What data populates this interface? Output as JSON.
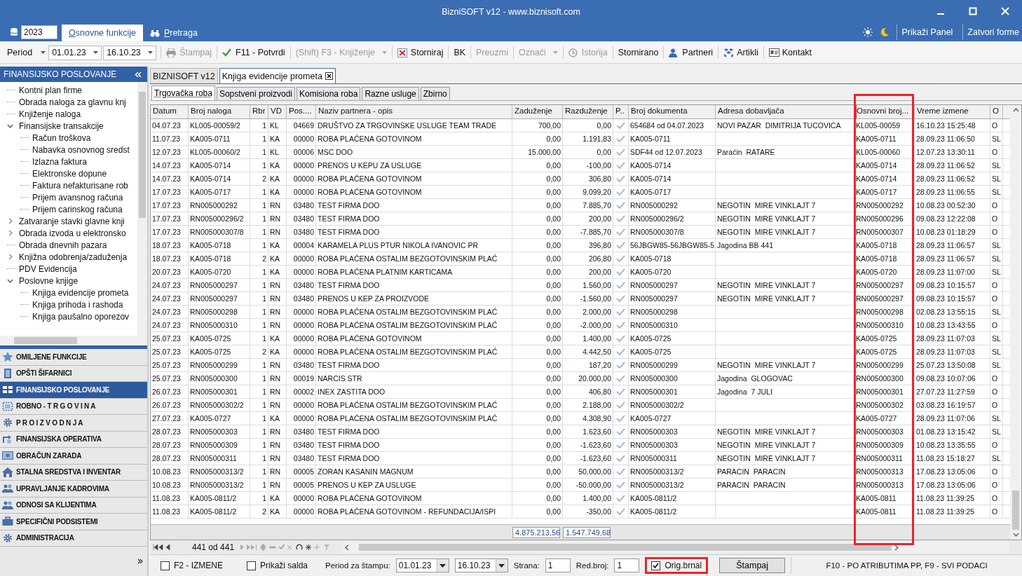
{
  "window": {
    "title": "BizniSOFT v12 - www.biznisoft.com"
  },
  "ribbon": {
    "year": "2023",
    "tabs": [
      {
        "label": "Osnovne funkcije",
        "selected": true
      },
      {
        "label": "Pretraga",
        "selected": false
      }
    ],
    "right_buttons": [
      "Prikaži Panel",
      "Zatvori forme"
    ]
  },
  "toolbar": {
    "period_label": "Period",
    "date_from": "01.01.23",
    "date_to": "16.10.23",
    "buttons": [
      {
        "label": "Štampaj",
        "disabled": true,
        "dropdown": false
      },
      {
        "label": "F11 - Potvrdi",
        "disabled": false,
        "dropdown": false
      },
      {
        "label": "(Shift) F3 - Knjiženje",
        "disabled": true,
        "dropdown": true
      },
      {
        "label": "Storniraj",
        "disabled": false,
        "dropdown": false
      },
      {
        "label": "BK",
        "disabled": false,
        "dropdown": false
      },
      {
        "label": "Preuzmi",
        "disabled": true,
        "dropdown": false
      },
      {
        "label": "Označi",
        "disabled": true,
        "dropdown": true
      },
      {
        "label": "Istorija",
        "disabled": true,
        "dropdown": false
      },
      {
        "label": "Stornirano",
        "disabled": false,
        "dropdown": false
      },
      {
        "label": "Partneri",
        "disabled": false,
        "dropdown": false
      },
      {
        "label": "Artikli",
        "disabled": false,
        "dropdown": false
      },
      {
        "label": "Kontakt",
        "disabled": false,
        "dropdown": false
      }
    ]
  },
  "sidebar": {
    "title": "FINANSIJSKO POSLOVANJE",
    "tree": [
      {
        "label": "Kontni plan firme"
      },
      {
        "label": "Obrada naloga za glavnu knj"
      },
      {
        "label": "Knjiženje naloga"
      },
      {
        "label": "Finansijske transakcije",
        "expanded": true,
        "children": [
          {
            "label": "Račun troškova"
          },
          {
            "label": "Nabavka osnovnog sredst"
          },
          {
            "label": "Izlazna faktura"
          },
          {
            "label": "Elektronske dopune"
          },
          {
            "label": "Faktura nefakturisane rob"
          },
          {
            "label": "Prijem avansnog računa"
          },
          {
            "label": "Prijem carinskog računa"
          }
        ]
      },
      {
        "label": "Zatvaranje stavki glavne knji",
        "expanded": false
      },
      {
        "label": "Obrada izvoda u elektronsko",
        "expanded": false
      },
      {
        "label": "Obrada dnevnih pazara"
      },
      {
        "label": "Knjižna odobrenja/zaduženja",
        "expanded": false
      },
      {
        "label": "PDV Evidencija"
      },
      {
        "label": "Poslovne knjige",
        "expanded": true,
        "children": [
          {
            "label": "Knjiga evidencije prometa"
          },
          {
            "label": "Knjiga prihoda i rashoda"
          },
          {
            "label": "Knjiga paušalno oporezov"
          }
        ]
      }
    ],
    "sections": [
      {
        "label": "OMILJENE FUNKCIJE",
        "selected": false
      },
      {
        "label": "OPŠTI ŠIFARNICI",
        "selected": false
      },
      {
        "label": "FINANSIJSKO POSLOVANJE",
        "selected": true
      },
      {
        "label": "ROBNO - T R G O V I N A",
        "selected": false
      },
      {
        "label": "P R O I Z V O D N J A",
        "selected": false
      },
      {
        "label": "FINANSIJSKA OPERATIVA",
        "selected": false
      },
      {
        "label": "OBRAČUN ZARADA",
        "selected": false
      },
      {
        "label": "STALNA SREDSTVA I INVENTAR",
        "selected": false
      },
      {
        "label": "UPRAVLJANJE KADROVIMA",
        "selected": false
      },
      {
        "label": "ODNOSI SA KLIJENTIMA",
        "selected": false
      },
      {
        "label": "SPECIFIČNI PODSISTEMI",
        "selected": false
      },
      {
        "label": "ADMINISTRACIJA",
        "selected": false
      }
    ]
  },
  "doc_tabs": [
    {
      "label": "BIZNISOFT v12",
      "selected": false,
      "closable": false
    },
    {
      "label": "Knjiga evidencije prometa",
      "selected": true,
      "closable": true
    }
  ],
  "sub_tabs": [
    {
      "label": "Trgovačka roba",
      "selected": true
    },
    {
      "label": "Sopstveni proizvodi",
      "selected": false
    },
    {
      "label": "Komisiona roba",
      "selected": false
    },
    {
      "label": "Razne usluge",
      "selected": false
    },
    {
      "label": "Zbirno",
      "selected": false
    }
  ],
  "table": {
    "columns": [
      {
        "label": "Datum",
        "kind": "text",
        "highlight": false
      },
      {
        "label": "Broj naloga",
        "kind": "text",
        "highlight": false
      },
      {
        "label": "Rbr",
        "kind": "num",
        "highlight": false
      },
      {
        "label": "VD",
        "kind": "text",
        "highlight": false
      },
      {
        "label": "Pos....",
        "kind": "num",
        "highlight": false
      },
      {
        "label": "Naziv partnera - opis",
        "kind": "text",
        "highlight": false
      },
      {
        "label": "Zaduženje",
        "kind": "num",
        "highlight": false
      },
      {
        "label": "Razduženje",
        "kind": "num",
        "highlight": false
      },
      {
        "label": "P..",
        "kind": "check",
        "highlight": false
      },
      {
        "label": "Broj dokumenta",
        "kind": "text",
        "highlight": false
      },
      {
        "label": "Adresa dobavljača",
        "kind": "text",
        "highlight": false
      },
      {
        "label": "Osnovni broj...",
        "kind": "text",
        "highlight": true
      },
      {
        "label": "Vreme izmene",
        "kind": "text",
        "highlight": false
      },
      {
        "label": "O",
        "kind": "text",
        "highlight": false
      }
    ],
    "rows": [
      [
        "04.07.23",
        "KL005-00059/2",
        "1",
        "KL",
        "04669",
        "DRUŠTVO ZA TRGOVINSKE USLUGE TEAM TRADE",
        "700,00",
        "0,00",
        true,
        "654684 od 04.07.2023",
        "NOVI PAZAR  DIMITRIJA TUCOVICA",
        "KL005-00059",
        "16.10.23 15:25:48",
        "O"
      ],
      [
        "11.07.23",
        "KA005-0711",
        "1",
        "KA",
        "00000",
        "ROBA PLAĆENA GOTOVINOM",
        "0,00",
        "1.191,83",
        true,
        "KA005-0711",
        null,
        "KA005-0711",
        "28.09.23 11:06:50",
        "SL"
      ],
      [
        "12.07.23",
        "KL005-00060/2",
        "1",
        "KL",
        "00006",
        "MSC DOO",
        "15.000,00",
        "0,00",
        true,
        "SDF44 od 12.07.2023",
        "Paraćin  RATARE",
        "KL005-00060",
        "12.07.23 13:30:11",
        "O"
      ],
      [
        "14.07.23",
        "KA005-0714",
        "1",
        "KA",
        "00000",
        "PRENOS U KEPU ZA USLUGE",
        "0,00",
        "-100,00",
        true,
        "KA005-0714",
        null,
        "KA005-0714",
        "28.09.23 11:06:52",
        "SL"
      ],
      [
        "14.07.23",
        "KA005-0714",
        "2",
        "KA",
        "00000",
        "ROBA PLAĆENA GOTOVINOM",
        "0,00",
        "306,80",
        true,
        "KA005-0714",
        null,
        "KA005-0714",
        "28.09.23 11:06:52",
        "SL"
      ],
      [
        "17.07.23",
        "KA005-0717",
        "1",
        "KA",
        "00000",
        "ROBA PLAĆENA GOTOVINOM",
        "0,00",
        "9.099,20",
        true,
        "KA005-0717",
        null,
        "KA005-0717",
        "28.09.23 11:06:55",
        "SL"
      ],
      [
        "17.07.23",
        "RN005000292",
        "1",
        "RN",
        "03480",
        "TEST FIRMA DOO",
        "0,00",
        "7.885,70",
        true,
        "RN005000292",
        "NEGOTIN  MIRE VINKLAJT 7",
        "RN005000292",
        "10.08.23 00:52:30",
        "O"
      ],
      [
        "17.07.23",
        "RN005000296/2",
        "1",
        "RN",
        "03480",
        "TEST FIRMA DOO",
        "0,00",
        "200,00",
        true,
        "RN005000296/2",
        "NEGOTIN  MIRE VINKLAJT 7",
        "RN005000296",
        "09.08.23 12:22:08",
        "O"
      ],
      [
        "17.07.23",
        "RN005000307/8",
        "1",
        "RN",
        "03480",
        "TEST FIRMA DOO",
        "0,00",
        "-7.885,70",
        true,
        "RN005000307/8",
        "NEGOTIN  MIRE VINKLAJT 7",
        "RN005000307",
        "10.08.23 01:18:29",
        "O"
      ],
      [
        "18.07.23",
        "KA005-0718",
        "1",
        "KA",
        "00004",
        "KARAMELA PLUS PTUR NIKOLA IVANOVIC PR",
        "0,00",
        "396,80",
        true,
        "56JBGW85-56JBGW85-5",
        "Jagodina BB 441",
        "KA005-0718",
        "28.09.23 11:06:57",
        "SL"
      ],
      [
        "18.07.23",
        "KA005-0718",
        "2",
        "KA",
        "00000",
        "ROBA PLAĆENA OSTALIM BEZGOTOVINSKIM PLAĆ",
        "0,00",
        "206,80",
        true,
        "KA005-0718",
        null,
        "KA005-0718",
        "28.09.23 11:06:57",
        "SL"
      ],
      [
        "20.07.23",
        "KA005-0720",
        "1",
        "KA",
        "00000",
        "ROBA PLAĆENA PLATNIM KARTICAMA",
        "0,00",
        "200,00",
        true,
        "KA005-0720",
        null,
        "KA005-0720",
        "28.09.23 11:07:00",
        "SL"
      ],
      [
        "24.07.23",
        "RN005000297",
        "1",
        "RN",
        "03480",
        "TEST FIRMA DOO",
        "0,00",
        "1.560,00",
        true,
        "RN005000297",
        "NEGOTIN  MIRE VINKLAJT 7",
        "RN005000297",
        "09.08.23 10:15:57",
        "O"
      ],
      [
        "24.07.23",
        "RN005000297",
        "1",
        "RN",
        "03480",
        "PRENOS U KEP ZA PROIZVODE",
        "0,00",
        "-1.560,00",
        true,
        "RN005000297",
        "NEGOTIN  MIRE VINKLAJT 7",
        "RN005000297",
        "09.08.23 10:15:57",
        "O"
      ],
      [
        "24.07.23",
        "RN005000298",
        "1",
        "RN",
        "00000",
        "ROBA PLAĆENA OSTALIM BEZGOTOVINSKIM PLAĆ",
        "0,00",
        "2.000,00",
        true,
        "RN005000298",
        null,
        "RN005000298",
        "02.08.23 13:55:15",
        "SL"
      ],
      [
        "24.07.23",
        "RN005000310",
        "1",
        "RN",
        "00000",
        "ROBA PLAĆENA OSTALIM BEZGOTOVINSKIM PLAĆ",
        "0,00",
        "-2.000,00",
        true,
        "RN005000310",
        null,
        "RN005000310",
        "10.08.23 13:43:55",
        "O"
      ],
      [
        "25.07.23",
        "KA005-0725",
        "1",
        "KA",
        "00000",
        "ROBA PLAĆENA GOTOVINOM",
        "0,00",
        "1.400,00",
        true,
        "KA005-0725",
        null,
        "KA005-0725",
        "28.09.23 11:07:03",
        "SL"
      ],
      [
        "25.07.23",
        "KA005-0725",
        "2",
        "KA",
        "00000",
        "ROBA PLAĆENA OSTALIM BEZGOTOVINSKIM PLAĆ",
        "0,00",
        "4.442,50",
        true,
        "KA005-0725",
        null,
        "KA005-0725",
        "28.09.23 11:07:03",
        "SL"
      ],
      [
        "25.07.23",
        "RN005000299",
        "1",
        "RN",
        "03480",
        "TEST FIRMA DOO",
        "0,00",
        "187,20",
        true,
        "RN005000299",
        "NEGOTIN  MIRE VINKLAJT 7",
        "RN005000299",
        "25.07.23 13:50:08",
        "SL"
      ],
      [
        "25.07.23",
        "RN005000300",
        "1",
        "RN",
        "00019",
        "NARCIS STR",
        "0,00",
        "20.000,00",
        true,
        "RN005000300",
        "Jagodina  GLOGOVAC",
        "RN005000300",
        "09.08.23 10:07:06",
        "O"
      ],
      [
        "26.07.23",
        "RN005000301",
        "1",
        "RN",
        "00002",
        "INEX ZASTITA DOO",
        "0,00",
        "406,80",
        true,
        "RN005000301",
        "Jagodina  7 JULI",
        "RN005000301",
        "27.07.23 11:27:59",
        "O"
      ],
      [
        "26.07.23",
        "RN005000302/2",
        "1",
        "RN",
        "00000",
        "ROBA PLAĆENA OSTALIM BEZGOTOVINSKIM PLAĆ",
        "0,00",
        "2.188,00",
        true,
        "RN005000302/2",
        null,
        "RN005000302",
        "03.08.23 16:19:57",
        "O"
      ],
      [
        "27.07.23",
        "KA005-0727",
        "1",
        "KA",
        "00000",
        "ROBA PLAĆENA OSTALIM BEZGOTOVINSKIM PLAĆ",
        "0,00",
        "4.308,90",
        true,
        "KA005-0727",
        null,
        "KA005-0727",
        "28.09.23 11:07:06",
        "SL"
      ],
      [
        "28.07.23",
        "RN005000303",
        "1",
        "RN",
        "03480",
        "TEST FIRMA DOO",
        "0,00",
        "1.623,60",
        true,
        "RN005000303",
        "NEGOTIN  MIRE VINKLAJT 7",
        "RN005000303",
        "01.08.23 13:15:42",
        "SL"
      ],
      [
        "28.07.23",
        "RN005000309",
        "1",
        "RN",
        "03480",
        "TEST FIRMA DOO",
        "0,00",
        "-1.623,60",
        true,
        "RN005000303",
        "NEGOTIN  MIRE VINKLAJT 7",
        "RN005000309",
        "10.08.23 13:35:55",
        "O"
      ],
      [
        "28.07.23",
        "RN005000311",
        "1",
        "RN",
        "03480",
        "TEST FIRMA DOO",
        "0,00",
        "-1.623,60",
        true,
        "RN005000311",
        "NEGOTIN  MIRE VINKLAJT 7",
        "RN005000311",
        "11.08.23 15:18:27",
        "SL"
      ],
      [
        "10.08.23",
        "RN005000313/2",
        "1",
        "RN",
        "00005",
        "ZORAN KASANIN MAGNUM",
        "0,00",
        "50.000,00",
        true,
        "RN005000313/2",
        "PARACIN  PARACIN",
        "RN005000313",
        "17.08.23 13:05:06",
        "O"
      ],
      [
        "10.08.23",
        "RN005000313/2",
        "1",
        "RN",
        "00005",
        "PRENOS U KEP ZA USLUGE",
        "0,00",
        "-50.000,00",
        true,
        "RN005000313/2",
        "PARACIN  PARACIN",
        "RN005000313",
        "17.08.23 13:05:06",
        "O"
      ],
      [
        "11.08.23",
        "KA005-0811/2",
        "1",
        "KA",
        "00000",
        "ROBA PLAĆENA GOTOVINOM",
        "0,00",
        "1.400,00",
        true,
        "KA005-0811/2",
        null,
        "KA005-0811",
        "11.08.23 11:39:25",
        "O"
      ],
      [
        "11.08.23",
        "KA005-0811/2",
        "2",
        "KA",
        "00000",
        "ROBA PLAĆENA GOTOVINOM - REFUNDACIJA/ISPI",
        "0,00",
        "-350,00",
        true,
        "KA005-0811/2",
        null,
        "KA005-0811",
        "11.08.23 11:39:25",
        "O"
      ]
    ],
    "totals": {
      "zaduzenje": "4.875.213,56",
      "razduzenje": "1.547.749,68"
    }
  },
  "navigator": {
    "position": "441 od 441"
  },
  "bottom_bar": [
    {
      "kind": "checkbox",
      "label": "F2 - IZMENE",
      "checked": false,
      "highlight": false
    },
    {
      "kind": "checkbox",
      "label": "Prikaži salda",
      "checked": false,
      "highlight": false
    },
    {
      "kind": "dates",
      "label": "Period za štampu:",
      "from": "01.01.23",
      "to": "16.10.23"
    },
    {
      "kind": "field",
      "label": "Strana:",
      "value": "1"
    },
    {
      "kind": "field",
      "label": "Red.broj:",
      "value": "1"
    },
    {
      "kind": "checkbox",
      "label": "Orig.brnal",
      "checked": true,
      "highlight": true
    },
    {
      "kind": "button",
      "label": "Štampaj"
    },
    {
      "kind": "hint",
      "label": "F10 - PO ATRIBUTIMA PP, F9 - SVI PODACI"
    }
  ]
}
